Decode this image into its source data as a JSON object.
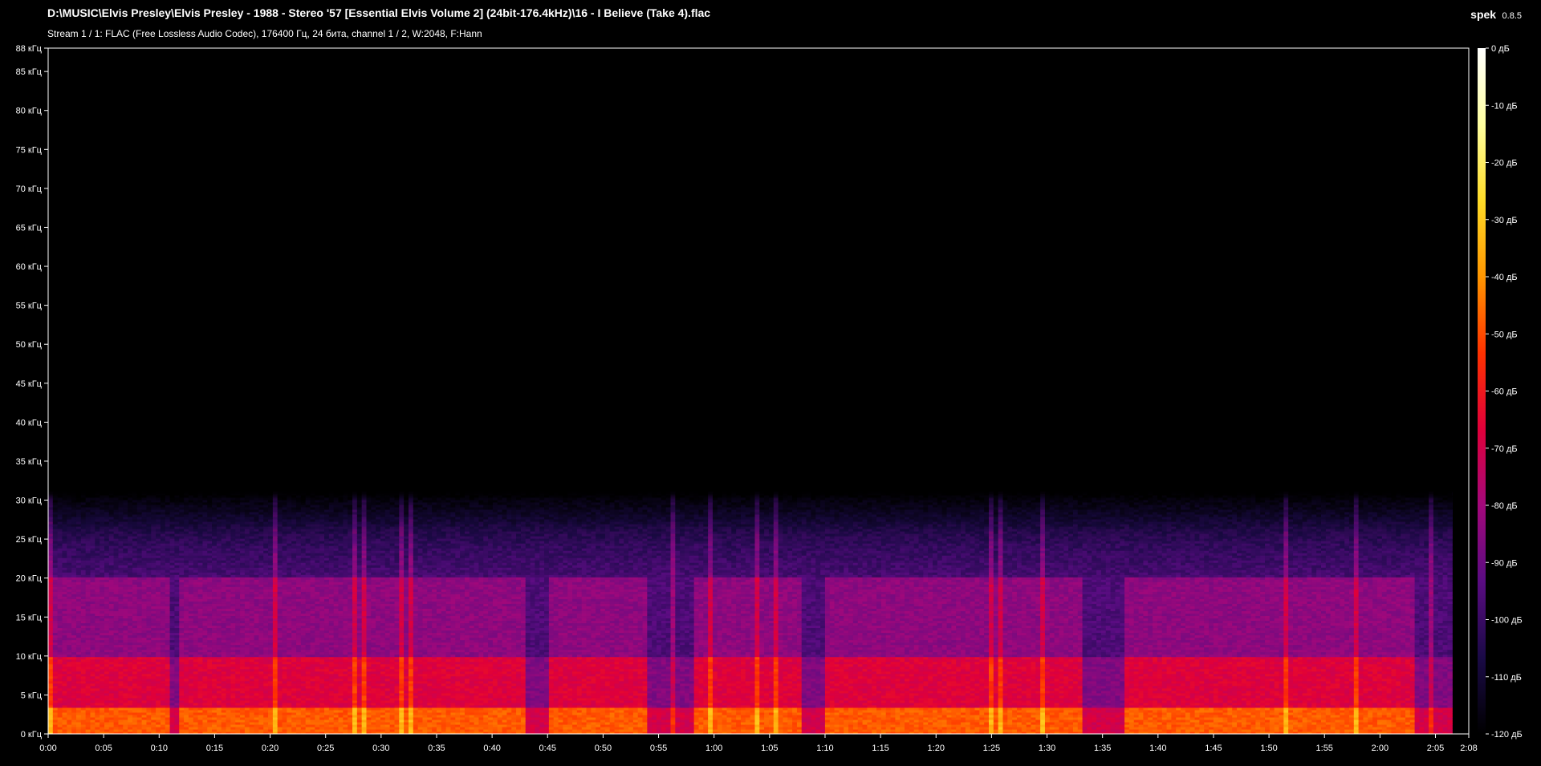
{
  "header": {
    "file_path": "D:\\MUSIC\\Elvis Presley\\Elvis Presley - 1988 - Stereo '57 [Essential Elvis Volume 2] (24bit-176.4kHz)\\16 - I Believe (Take 4).flac",
    "stream_info": "Stream 1 / 1: FLAC (Free Lossless Audio Codec), 176400 Гц, 24 бита, channel 1 / 2, W:2048, F:Hann",
    "app_name": "spek",
    "app_version": "0.8.5"
  },
  "chart_data": {
    "type": "heatmap",
    "frequency_axis": {
      "unit": "кГц",
      "range": [
        0,
        88
      ],
      "tick_labels": [
        "0 кГц",
        "5 кГц",
        "10 кГц",
        "15 кГц",
        "20 кГц",
        "25 кГц",
        "30 кГц",
        "35 кГц",
        "40 кГц",
        "45 кГц",
        "50 кГц",
        "55 кГц",
        "60 кГц",
        "65 кГц",
        "70 кГц",
        "75 кГц",
        "80 кГц",
        "85 кГц",
        "88 кГц"
      ],
      "tick_values": [
        0,
        5,
        10,
        15,
        20,
        25,
        30,
        35,
        40,
        45,
        50,
        55,
        60,
        65,
        70,
        75,
        80,
        85,
        88
      ]
    },
    "time_axis": {
      "range_seconds": [
        0,
        128
      ],
      "tick_labels": [
        "0:00",
        "0:05",
        "0:10",
        "0:15",
        "0:20",
        "0:25",
        "0:30",
        "0:35",
        "0:40",
        "0:45",
        "0:50",
        "0:55",
        "1:00",
        "1:05",
        "1:10",
        "1:15",
        "1:20",
        "1:25",
        "1:30",
        "1:35",
        "1:40",
        "1:45",
        "1:50",
        "1:55",
        "2:00",
        "2:05",
        "2:08"
      ],
      "tick_values": [
        0,
        5,
        10,
        15,
        20,
        25,
        30,
        35,
        40,
        45,
        50,
        55,
        60,
        65,
        70,
        75,
        80,
        85,
        90,
        95,
        100,
        105,
        110,
        115,
        120,
        125,
        128
      ]
    },
    "color_scale": {
      "unit": "дБ",
      "range": [
        -120,
        0
      ],
      "tick_labels": [
        "0 дБ",
        "-10 дБ",
        "-20 дБ",
        "-30 дБ",
        "-40 дБ",
        "-50 дБ",
        "-60 дБ",
        "-70 дБ",
        "-80 дБ",
        "-90 дБ",
        "-100 дБ",
        "-110 дБ",
        "-120 дБ"
      ],
      "tick_values": [
        0,
        -10,
        -20,
        -30,
        -40,
        -50,
        -60,
        -70,
        -80,
        -90,
        -100,
        -110,
        -120
      ],
      "colors": [
        "#000000",
        "#1a0a46",
        "#5a0c82",
        "#a3087b",
        "#e0003a",
        "#ff3200",
        "#ff9600",
        "#ffdc28",
        "#ffffa0",
        "#ffffff"
      ]
    },
    "signal": {
      "audio_end_seconds": 126.5,
      "cutoff_khz": 31
    },
    "loud_passages_seconds": [
      [
        0,
        11
      ],
      [
        12,
        24
      ],
      [
        24,
        43
      ],
      [
        45,
        54
      ],
      [
        58,
        68
      ],
      [
        70,
        93
      ],
      [
        97,
        118
      ],
      [
        118,
        123
      ]
    ],
    "quiet_passages_seconds": [
      [
        11,
        12
      ],
      [
        43,
        45
      ],
      [
        54,
        58
      ],
      [
        68,
        70
      ],
      [
        93,
        97
      ],
      [
        123,
        126.5
      ]
    ]
  }
}
